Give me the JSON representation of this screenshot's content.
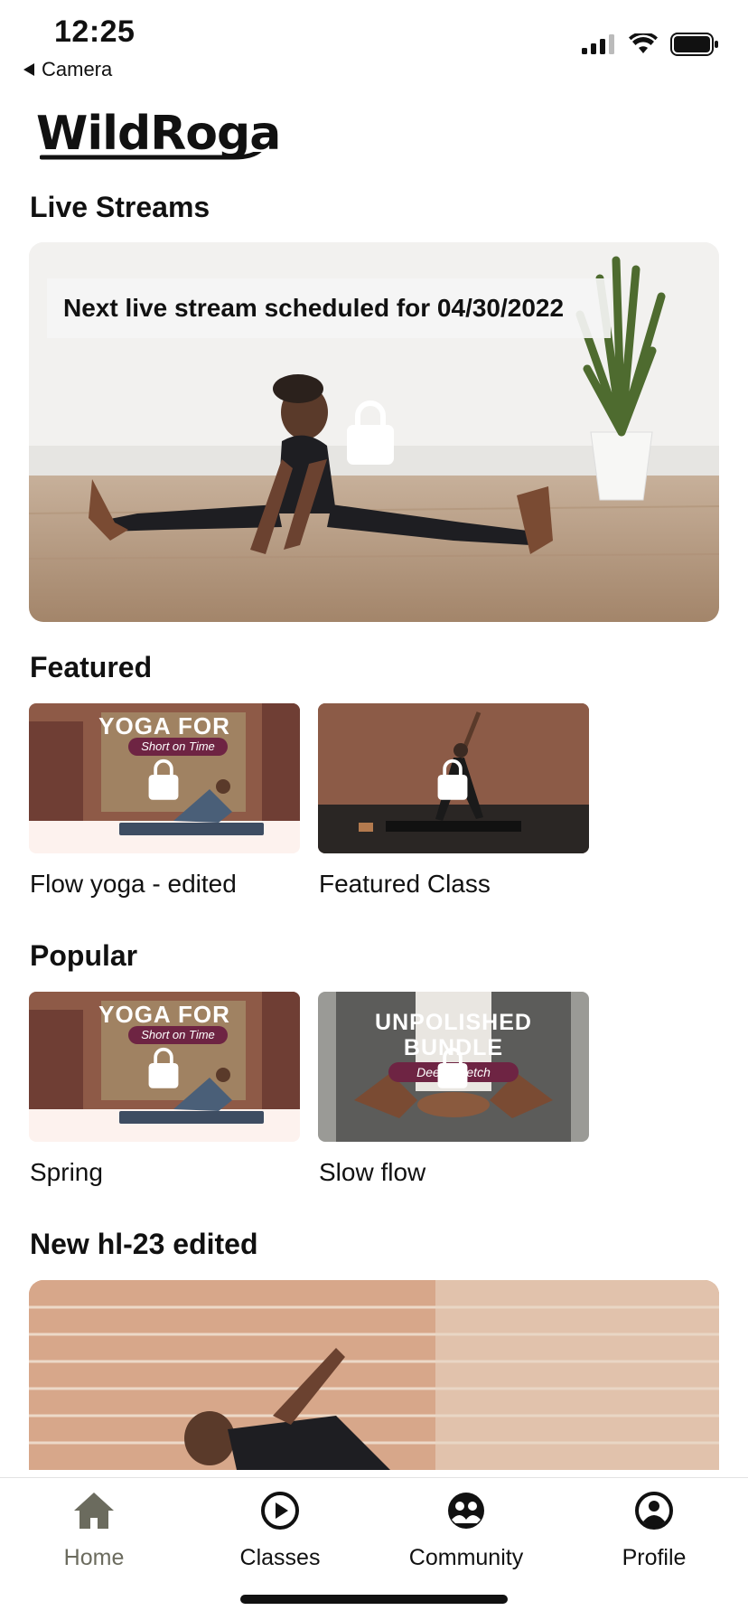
{
  "status": {
    "time": "12:25",
    "back_app": "Camera"
  },
  "logo": {
    "text": "WildRoga"
  },
  "live_streams": {
    "title": "Live Streams",
    "banner": "Next live stream scheduled for 04/30/2022"
  },
  "featured": {
    "title": "Featured",
    "items": [
      {
        "label": "Flow yoga - edited",
        "overlay_title": "YOGA FOR",
        "overlay_sub": "Short on Time"
      },
      {
        "label": "Featured Class"
      }
    ]
  },
  "popular": {
    "title": "Popular",
    "items": [
      {
        "label": "Spring",
        "overlay_title": "YOGA FOR",
        "overlay_sub": "Short on Time"
      },
      {
        "label": "Slow flow",
        "overlay_title_1": "UNPOLISHED",
        "overlay_title_2": "BUNDLE",
        "overlay_sub": "Deep Stretch"
      }
    ]
  },
  "new_section": {
    "title": "New hl-23 edited"
  },
  "tabs": [
    {
      "label": "Home",
      "icon": "home-icon",
      "active": true
    },
    {
      "label": "Classes",
      "icon": "play-circle-icon",
      "active": false
    },
    {
      "label": "Community",
      "icon": "community-icon",
      "active": false
    },
    {
      "label": "Profile",
      "icon": "profile-icon",
      "active": false
    }
  ],
  "colors": {
    "active_tab": "#6b6b5e",
    "text": "#111111",
    "accent": "#6e2443"
  }
}
